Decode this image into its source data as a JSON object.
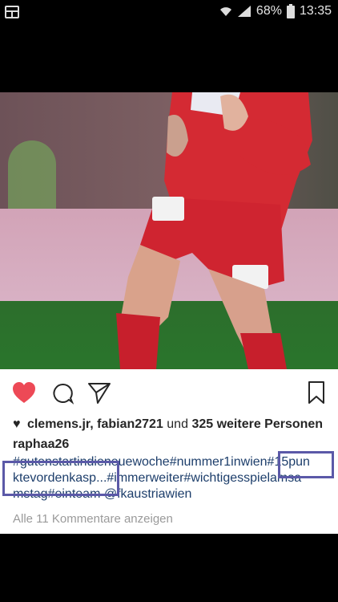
{
  "status_bar": {
    "battery_percent": "68%",
    "time": "13:35"
  },
  "post": {
    "likes_text_names": "clemens.jr, fabian2721",
    "likes_text_connector": "und",
    "likes_count_text": "325 weitere Personen",
    "author": "raphaa26",
    "caption_lines": [
      "#gutenstartindieneuewoche#nummer1inwien#15pun",
      "ktevordenkasp...#immerweiter#wichtigesspielamsa",
      "mstag#einteam @fkaustriawien"
    ],
    "comments_link": "Alle 11 Kommentare anzeigen"
  },
  "icons": {
    "like": "heart-icon",
    "comment": "comment-icon",
    "share": "send-icon",
    "save": "bookmark-icon"
  },
  "colors": {
    "like_red": "#ed4956",
    "link_blue": "#1d3e6b",
    "highlight_purple": "#5b59a8"
  }
}
